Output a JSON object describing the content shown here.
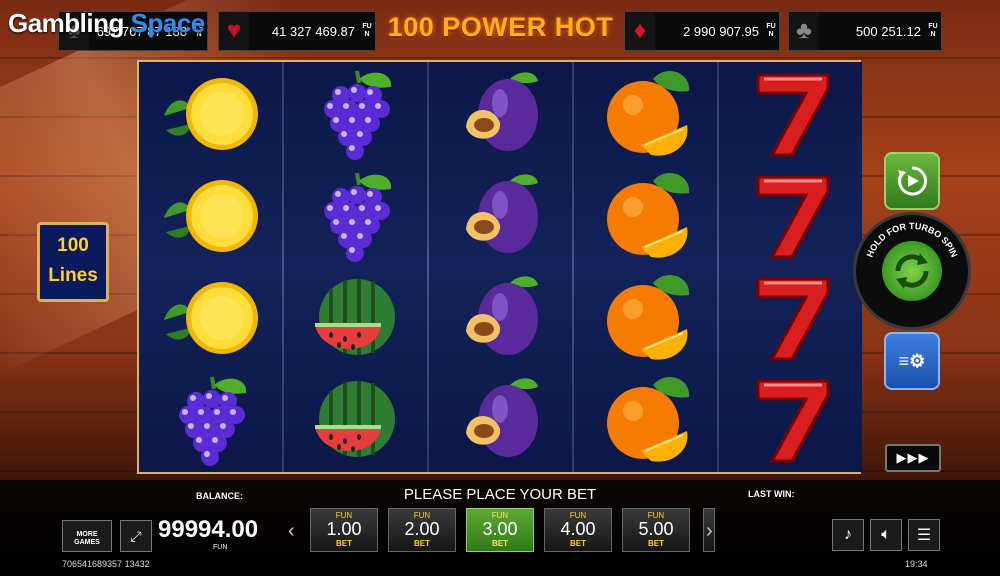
{
  "logo": {
    "word1": "Gambling",
    "word2": "Space"
  },
  "title": "100 POWER HOT",
  "jackpots": [
    {
      "suit": "spade-icon",
      "glyph": "♠",
      "value": "697 767 87 188",
      "fun": "FUN",
      "color": "#2a2a2a"
    },
    {
      "suit": "heart-icon",
      "glyph": "♥",
      "value": "41 327 469.87",
      "fun": "FUN",
      "color": "#c8102e"
    },
    {
      "suit": "diamond-icon",
      "glyph": "♦",
      "value": "2 990 907.95",
      "fun": "FUN",
      "color": "#c8102e"
    },
    {
      "suit": "club-icon",
      "glyph": "♣",
      "value": "500 251.12",
      "fun": "FUN",
      "color": "#2a2a2a"
    }
  ],
  "lines_badge": {
    "number": "100",
    "word": "Lines"
  },
  "reels": [
    [
      "lemon",
      "lemon",
      "lemon",
      "grapes"
    ],
    [
      "grapes",
      "grapes",
      "watermelon",
      "watermelon"
    ],
    [
      "plum",
      "plum",
      "plum",
      "plum"
    ],
    [
      "orange",
      "orange",
      "orange",
      "orange"
    ],
    [
      "seven",
      "seven",
      "seven",
      "seven"
    ]
  ],
  "controls": {
    "turbo_text": "HOLD FOR TURBO SPIN",
    "fast_forward": "▶▶▶"
  },
  "bottom": {
    "balance_label": "BALANCE:",
    "balance_value": "99994.00",
    "balance_currency": "FUN",
    "message": "PLEASE PLACE YOUR BET",
    "last_win_label": "LAST WIN:",
    "more_games": "MORE GAMES",
    "bets": [
      {
        "fun": "FUN",
        "value": "1.00",
        "bet": "BET",
        "selected": false
      },
      {
        "fun": "FUN",
        "value": "2.00",
        "bet": "BET",
        "selected": false
      },
      {
        "fun": "FUN",
        "value": "3.00",
        "bet": "BET",
        "selected": true
      },
      {
        "fun": "FUN",
        "value": "4.00",
        "bet": "BET",
        "selected": false
      },
      {
        "fun": "FUN",
        "value": "5.00",
        "bet": "BET",
        "selected": false
      }
    ],
    "game_id": "706541689357 13432",
    "clock": "19:34"
  }
}
